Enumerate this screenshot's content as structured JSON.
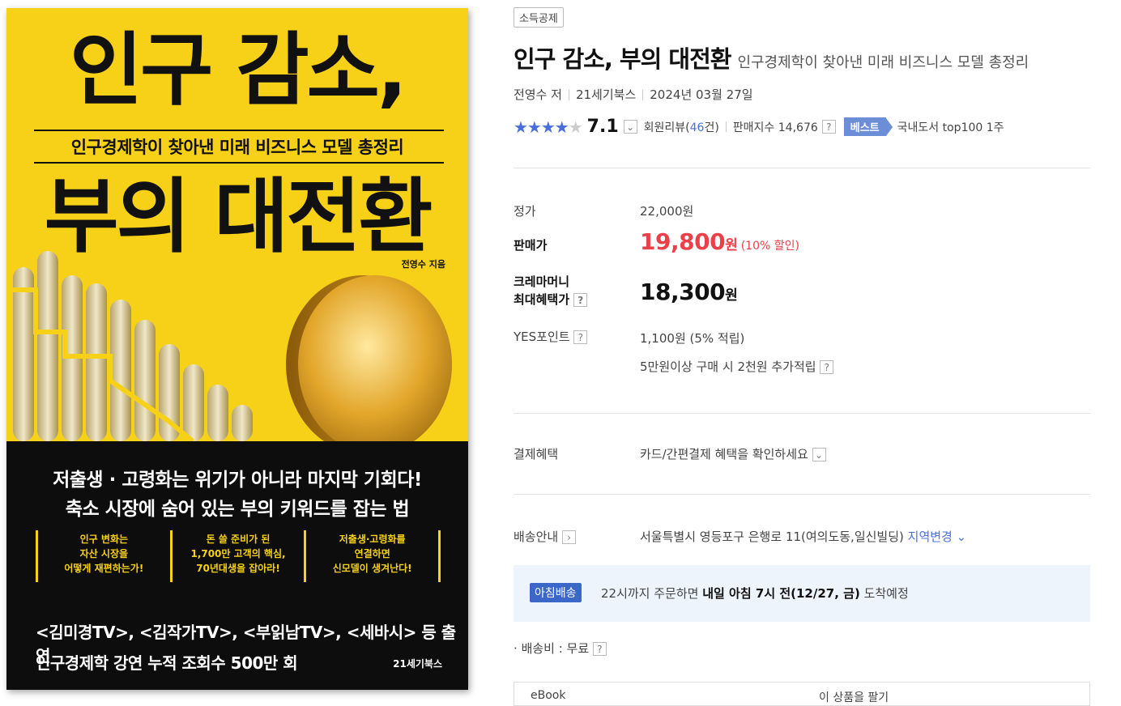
{
  "cover": {
    "title_line1": "인구 감소,",
    "subtitle": "인구경제학이 찾아낸 미래 비즈니스 모델 총정리",
    "title_line2": "부의 대전환",
    "author": "전영수 지음",
    "headline1": "저출생 · 고령화는 위기가 아니라 마지막 기회다!",
    "headline2": "축소 시장에 숨어 있는 부의 키워드를 잡는 법",
    "columns": [
      {
        "l1": "인구 변화는",
        "l2": "자산 시장을",
        "l3": "어떻게 재편하는가!"
      },
      {
        "l1": "돈 쓸 준비가 된",
        "l2": "1,700만 고객의 핵심,",
        "l3": "70년대생을 잡아라!"
      },
      {
        "l1": "저출생·고령화를",
        "l2": "연결하면",
        "l3": "신모델이 생겨난다!"
      }
    ],
    "promo1": "<김미경TV>, <김작가TV>, <부읽남TV>, <세바시> 등 출연",
    "promo2": "인구경제학 강연 누적 조회수 500만 회",
    "publisher_logo": "21세기북스"
  },
  "product": {
    "tag": "소득공제",
    "title": "인구 감소, 부의 대전환",
    "subtitle": "인구경제학이 찾아낸 미래 비즈니스 모델 총정리",
    "author": "전영수 저",
    "publisher": "21세기북스",
    "date": "2024년 03월 27일",
    "rating": "7.1",
    "review_label": "회원리뷰(",
    "review_count": "46",
    "review_suffix": "건)",
    "sales_index": "판매지수 14,676",
    "best_badge": "베스트",
    "best_rank": "국내도서 top100 1주"
  },
  "price": {
    "list_label": "정가",
    "list_value": "22,000원",
    "sale_label": "판매가",
    "sale_value": "19,800",
    "sale_unit": "원",
    "sale_discount": "(10% 할인)",
    "max_label1": "크레마머니",
    "max_label2": "최대혜택가",
    "max_value": "18,300",
    "max_unit": "원",
    "points_label": "YES포인트",
    "points_value": "1,100원 (5% 적립)",
    "points_extra": "5만원이상 구매 시 2천원 추가적립"
  },
  "payment": {
    "label": "결제혜택",
    "value": "카드/간편결제 혜택을 확인하세요"
  },
  "delivery": {
    "label": "배송안내",
    "address": "서울특별시 영등포구 은행로 11(여의도동,일신빌딩)",
    "change_link": "지역변경",
    "morning_badge": "아침배송",
    "morning_text_pre": "22시까지 주문하면 ",
    "morning_text_bold": "내일 아침 7시 전(12/27, 금)",
    "morning_text_post": " 도착예정",
    "shipping_fee": "배송비 : 무료"
  },
  "bottom_table": {
    "left": "eBook",
    "right": "이 상품을 팔기"
  },
  "colors": {
    "cover_yellow": "#f7d117",
    "sale_red": "#ec4048",
    "accent_blue": "#4a6fdc",
    "badge_blue": "#3b67c9"
  }
}
